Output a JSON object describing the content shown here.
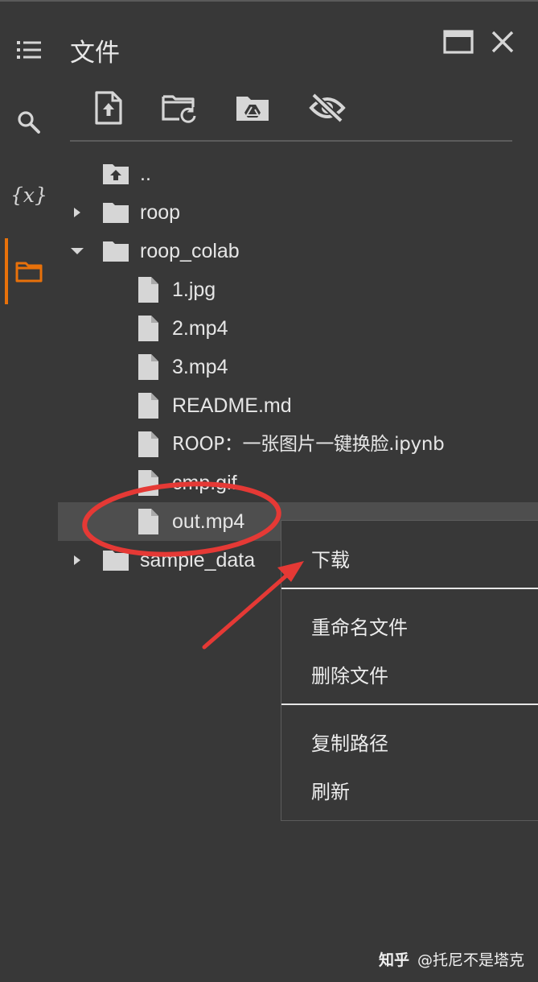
{
  "panel": {
    "title": "文件"
  },
  "rail": {
    "items": [
      {
        "icon": "list-icon"
      },
      {
        "icon": "search-icon"
      },
      {
        "icon": "variables-icon",
        "label": "{x}"
      },
      {
        "icon": "folder-icon",
        "active": true
      }
    ],
    "accent": "#e8710a"
  },
  "toolbar": {
    "buttons": [
      {
        "icon": "upload-file-icon"
      },
      {
        "icon": "refresh-folder-icon"
      },
      {
        "icon": "mount-drive-icon"
      },
      {
        "icon": "hide-icon"
      }
    ]
  },
  "tree": {
    "parent_label": "..",
    "items": [
      {
        "name": "roop",
        "type": "folder",
        "expanded": false
      },
      {
        "name": "roop_colab",
        "type": "folder",
        "expanded": true
      },
      {
        "name": "1.jpg",
        "type": "file"
      },
      {
        "name": "2.mp4",
        "type": "file"
      },
      {
        "name": "3.mp4",
        "type": "file"
      },
      {
        "name": "README.md",
        "type": "file"
      },
      {
        "name": "ROOP：一张图片一键换脸.ipynb",
        "type": "file"
      },
      {
        "name": "cmp.gif",
        "type": "file"
      },
      {
        "name": "out.mp4",
        "type": "file",
        "selected": true
      },
      {
        "name": "sample_data",
        "type": "folder",
        "expanded": false
      }
    ]
  },
  "context_menu": {
    "download": "下载",
    "rename": "重命名文件",
    "delete": "删除文件",
    "copy_path": "复制路径",
    "refresh": "刷新"
  },
  "annotation": {
    "color": "#e53935"
  },
  "watermark": {
    "logo": "知乎",
    "text": "@托尼不是塔克"
  }
}
